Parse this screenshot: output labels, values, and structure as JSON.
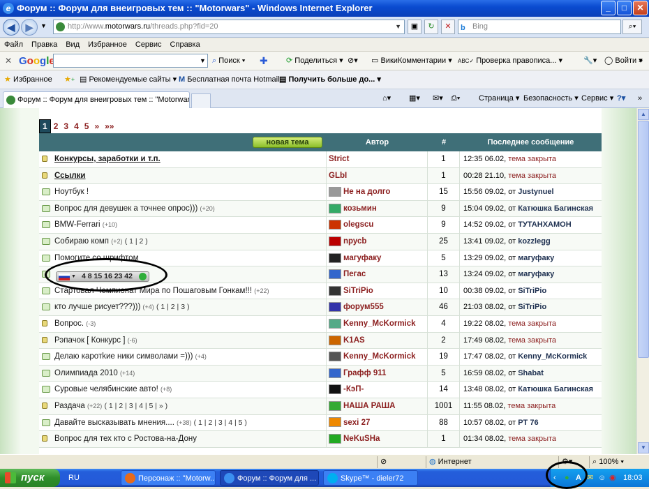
{
  "window": {
    "title": "Форум :: Форум для внеигровых тем :: \"Motorwars\" - Windows Internet Explorer",
    "url_prefix": "http://www.",
    "url_domain": "motorwars.ru",
    "url_path": "/threads.php?fid=20",
    "search_placeholder": "Bing"
  },
  "menu": [
    "Файл",
    "Правка",
    "Вид",
    "Избранное",
    "Сервис",
    "Справка"
  ],
  "google_toolbar": {
    "logo": "Google",
    "search": "Поиск",
    "share": "Поделиться",
    "wiki": "ВикиКомментарии",
    "spell": "Проверка правописа...",
    "login": "Войти"
  },
  "favorites_bar": {
    "favorites": "Избранное",
    "recommended": "Рекомендуемые сайты",
    "hotmail": "Бесплатная почта Hotmail",
    "more": "Получить больше до..."
  },
  "tab": {
    "title": "Форум :: Форум для внеигровых тем :: \"Motorwars\""
  },
  "command_bar": {
    "page": "Страница",
    "security": "Безопасность",
    "service": "Сервис"
  },
  "pagination": [
    "1",
    "2",
    "3",
    "4",
    "5",
    "»",
    "»»"
  ],
  "table": {
    "new_topic": "новая тема",
    "headers": {
      "author": "Автор",
      "count": "#",
      "last": "Последнее сообщение"
    },
    "closed_label": "тема закрыта",
    "from_label": "от"
  },
  "threads": [
    {
      "title": "Конкурсы, заработки и т.п.",
      "hint": "",
      "pages": "",
      "author": "Strict",
      "count": "1",
      "time": "12:35 06.02,",
      "closed": true,
      "last": ""
    },
    {
      "title": "Ссылки",
      "hint": "",
      "pages": "",
      "author": "GLbI",
      "count": "1",
      "time": "00:28 21.10,",
      "closed": true,
      "last": ""
    },
    {
      "title": "Ноутбук !",
      "hint": "",
      "pages": "",
      "author": "Не на долго",
      "count": "15",
      "time": "15:56 09.02,",
      "closed": false,
      "last": "Justynuel"
    },
    {
      "title": "Вопрос для девушек а точнее опрос)))",
      "hint": "(+20)",
      "pages": "",
      "author": "козьмин",
      "count": "9",
      "time": "15:04 09.02,",
      "closed": false,
      "last": "Катюшка Багинская"
    },
    {
      "title": "BMW-Ferrari",
      "hint": "(+10)",
      "pages": "",
      "author": "olegscu",
      "count": "9",
      "time": "14:52 09.02,",
      "closed": false,
      "last": "ТУТАНХАМОН"
    },
    {
      "title": "Собираю комп",
      "hint": "(+2)",
      "pages": "( 1 | 2 )",
      "author": "nрусb",
      "count": "25",
      "time": "13:41 09.02,",
      "closed": false,
      "last": "kozzlegg"
    },
    {
      "title": "Помогите со шрифтом",
      "hint": "",
      "pages": "",
      "author": "магуфаку",
      "count": "5",
      "time": "13:29 09.02,",
      "closed": false,
      "last": "магуфаку"
    },
    {
      "title": "",
      "hint": "",
      "pages": "",
      "author": "Пегас",
      "count": "13",
      "time": "13:24 09.02,",
      "closed": false,
      "last": "магуфаку"
    },
    {
      "title": "Стартовал Чемпионат Мира по Пошаговым Гонкам!!!",
      "hint": "(+22)",
      "pages": "",
      "author": "SiTriPio",
      "count": "10",
      "time": "00:38 09.02,",
      "closed": false,
      "last": "SiTriPio"
    },
    {
      "title": "кто лучше рисует???)))",
      "hint": "(+4)",
      "pages": "( 1 | 2 | 3 )",
      "author": "форум555",
      "count": "46",
      "time": "21:03 08.02,",
      "closed": false,
      "last": "SiTriPio"
    },
    {
      "title": "Вопрос.",
      "hint": "(-3)",
      "pages": "",
      "author": "Kenny_McKormick",
      "count": "4",
      "time": "19:22 08.02,",
      "closed": true,
      "last": ""
    },
    {
      "title": "Рэпачок [ Конкурс ]",
      "hint": "(-6)",
      "pages": "",
      "author": "K1AS",
      "count": "2",
      "time": "17:49 08.02,",
      "closed": true,
      "last": ""
    },
    {
      "title": "Делаю каротkие ники символами =)))",
      "hint": "(+4)",
      "pages": "",
      "author": "Kenny_McKormick",
      "count": "19",
      "time": "17:47 08.02,",
      "closed": false,
      "last": "Kenny_McKormick"
    },
    {
      "title": "Олимпиада 2010",
      "hint": "(+14)",
      "pages": "",
      "author": "Графф 911",
      "count": "5",
      "time": "16:59 08.02,",
      "closed": false,
      "last": "Shabat"
    },
    {
      "title": "Суровые челябинские авто!",
      "hint": "(+8)",
      "pages": "",
      "author": "-КэП-",
      "count": "14",
      "time": "13:48 08.02,",
      "closed": false,
      "last": "Катюшка Багинская"
    },
    {
      "title": "Раздача",
      "hint": "(+22)",
      "pages": "( 1 | 2 | 3 | 4 | 5 | » )",
      "author": "НАША РАША",
      "count": "1001",
      "time": "11:55 08.02,",
      "closed": true,
      "last": ""
    },
    {
      "title": "Давайте высказывать мнения....",
      "hint": "(+38)",
      "pages": "( 1 | 2 | 3 | 4 | 5 )",
      "author": "sexi 27",
      "count": "88",
      "time": "10:57 08.02,",
      "closed": false,
      "last": "PT 76"
    },
    {
      "title": "Вопрос для тех кто с Ростова-на-Дону",
      "hint": "",
      "pages": "",
      "author": "NeKuSHa",
      "count": "1",
      "time": "01:34 08.02,",
      "closed": true,
      "last": ""
    }
  ],
  "skype_widget": {
    "number": "4 8 15 16 23 42"
  },
  "status": {
    "zone": "Интернет",
    "zoom": "100%"
  },
  "taskbar": {
    "start": "пуск",
    "lang": "RU",
    "items": [
      "Персонаж :: \"Motorw...",
      "Форум :: Форум для ...",
      "Skype™ - dieler72"
    ],
    "clock": "18:03"
  }
}
